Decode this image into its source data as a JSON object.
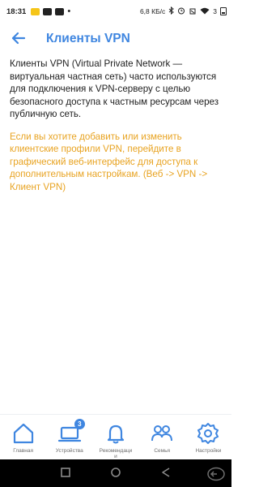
{
  "status_bar": {
    "time": "18:31",
    "net_speed": "6,8 КБ/с",
    "battery": "3"
  },
  "header": {
    "title": "Клиенты VPN"
  },
  "main": {
    "description": "Клиенты VPN (Virtual Private Network — виртуальная частная сеть) часто используются для подключения к VPN-серверу с целью безопасного доступа к частным ресурсам через публичную сеть.",
    "note": "Если вы хотите добавить или изменить клиентские профили VPN, перейдите в графический веб-интерфейс для доступа к дополнительным настройкам. (Веб -> VPN -> Клиент VPN)"
  },
  "bottom_nav": {
    "items": [
      {
        "label": "Главная",
        "icon": "home-icon"
      },
      {
        "label": "Устройства",
        "icon": "devices-icon",
        "badge": "3"
      },
      {
        "label": "Рекоменд­аци\nи",
        "icon": "bell-icon"
      },
      {
        "label": "Семья",
        "icon": "family-icon"
      },
      {
        "label": "Настройки",
        "icon": "gear-icon"
      }
    ]
  },
  "colors": {
    "accent": "#3f86e0",
    "note": "#e8a321"
  }
}
